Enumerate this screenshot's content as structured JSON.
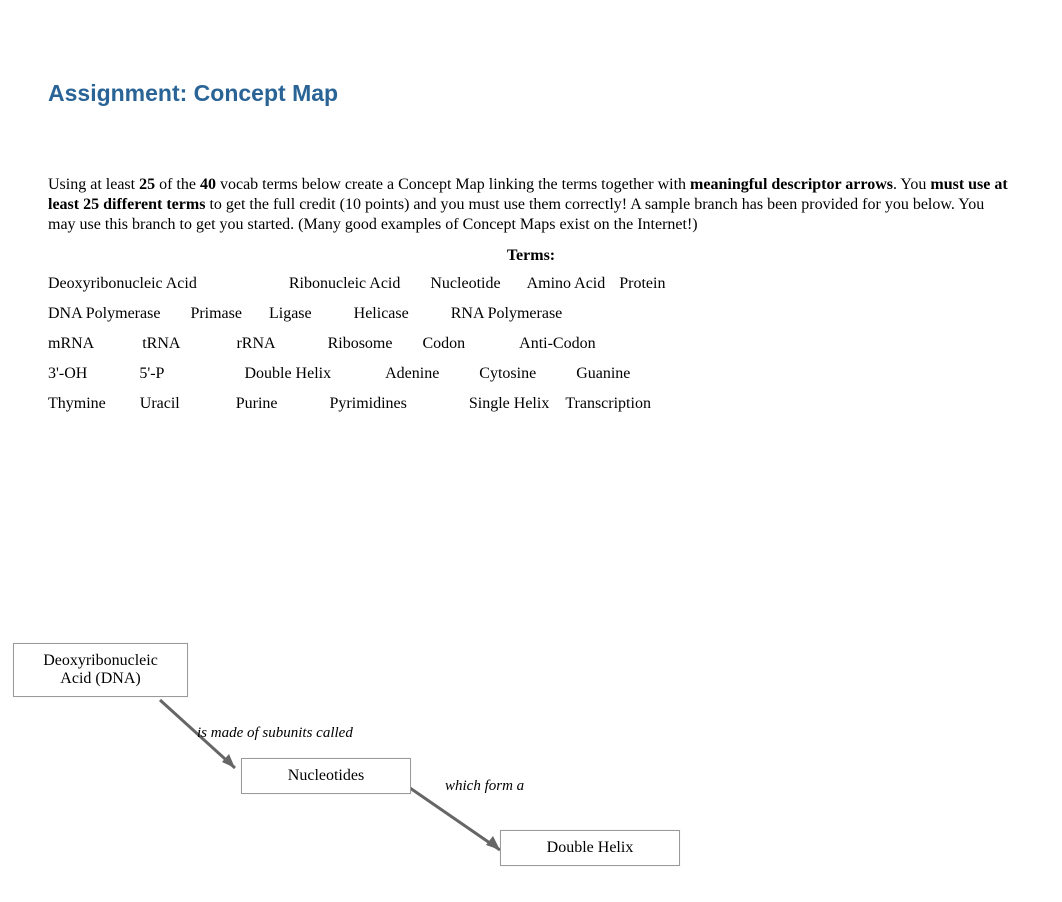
{
  "title": "Assignment: Concept Map",
  "instr": {
    "p1": "Using at least ",
    "n1": "25",
    "p2": " of the ",
    "n2": "40",
    "p3": " vocab terms below create a Concept Map linking the terms together with ",
    "b1": "meaningful descriptor arrows",
    "p4": ". You ",
    "b2": "must use at least 25 different terms",
    "p5": " to get the full credit (10 points) and you must use them correctly! A sample branch has been provided for you below. You may use this branch to get you started. (Many good examples of Concept Maps exist on the Internet!)"
  },
  "terms_heading": "Terms:",
  "terms_rows": [
    [
      "Deoxyribonucleic Acid",
      "Ribonucleic Acid",
      "Nucleotide",
      "Amino Acid",
      "Protein"
    ],
    [
      "DNA Polymerase",
      "Primase",
      "Ligase",
      "Helicase",
      "RNA Polymerase"
    ],
    [
      "mRNA",
      "tRNA",
      "rRNA",
      "Ribosome",
      "Codon",
      "Anti-Codon"
    ],
    [
      "3'-OH",
      "5'-P",
      "Double Helix",
      "Adenine",
      "Cytosine",
      "Guanine"
    ],
    [
      "Thymine",
      "Uracil",
      "Purine",
      "Pyrimidines",
      "Single Helix",
      "Transcription"
    ]
  ],
  "row_gaps": [
    [
      0,
      92,
      30,
      26,
      14
    ],
    [
      0,
      30,
      27,
      42,
      42
    ],
    [
      0,
      48,
      56,
      52,
      30,
      54
    ],
    [
      0,
      52,
      80,
      54,
      40,
      40
    ],
    [
      0,
      34,
      56,
      52,
      62,
      16
    ]
  ],
  "diagram": {
    "node1_l1": "Deoxyribonucleic",
    "node1_l2": "Acid (DNA)",
    "arrow1_label": "is made of subunits called",
    "node2": "Nucleotides",
    "arrow2_label": "which form a",
    "node3": "Double Helix"
  }
}
